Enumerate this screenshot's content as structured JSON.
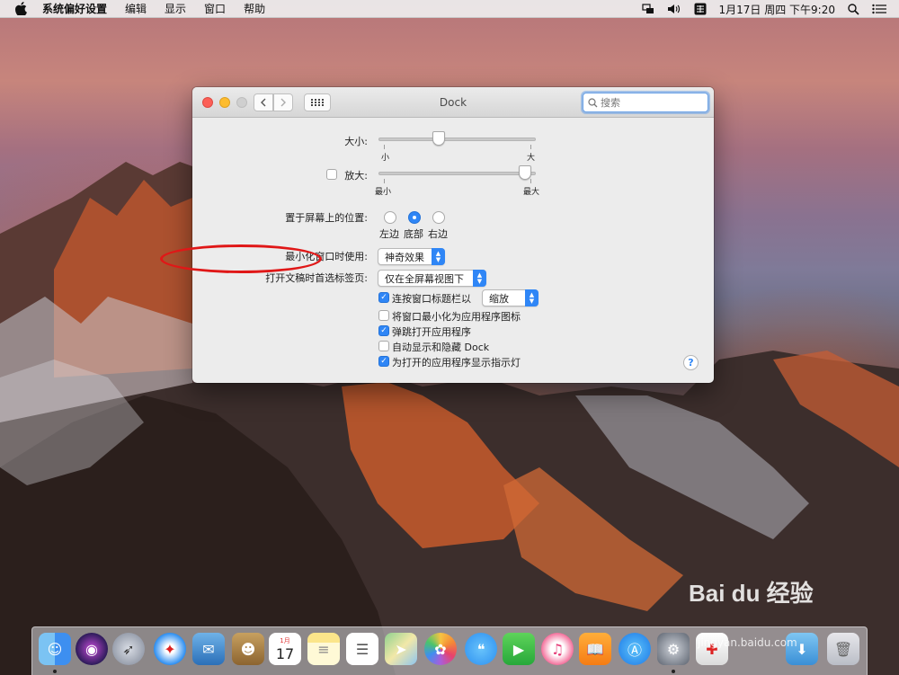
{
  "menubar": {
    "app_name": "系统偏好设置",
    "items": [
      "编辑",
      "显示",
      "窗口",
      "帮助"
    ],
    "clock": "1月17日 周四 下午9:20"
  },
  "window": {
    "title": "Dock",
    "search_placeholder": "搜索"
  },
  "settings": {
    "size_label": "大小:",
    "size_min": "小",
    "size_max": "大",
    "size_value": 0.37,
    "magnify_label": "放大:",
    "magnify_checked": false,
    "magnify_min": "最小",
    "magnify_max": "最大",
    "magnify_value": 0.97,
    "position_label": "置于屏幕上的位置:",
    "position_options": [
      "左边",
      "底部",
      "右边"
    ],
    "position_selected": "底部",
    "minimize_label": "最小化窗口时使用:",
    "minimize_value": "神奇效果",
    "tabs_label": "打开文稿时首选标签页:",
    "tabs_value": "仅在全屏幕视图下",
    "checkboxes": [
      {
        "label": "连按窗口标题栏以",
        "checked": true
      },
      {
        "label": "将窗口最小化为应用程序图标",
        "checked": false
      },
      {
        "label": "弹跳打开应用程序",
        "checked": true
      },
      {
        "label": "自动显示和隐藏 Dock",
        "checked": false
      },
      {
        "label": "为打开的应用程序显示指示灯",
        "checked": true
      }
    ],
    "doubleclick_value": "缩放"
  },
  "watermark": {
    "brand": "Bai du 经验",
    "url": "jingyan.baidu.com"
  },
  "dock": {
    "apps": [
      "finder",
      "siri",
      "launchpad",
      "safari",
      "mail",
      "contacts",
      "calendar",
      "notes",
      "reminders",
      "maps",
      "photos",
      "messages",
      "facetime",
      "itunes",
      "ibooks",
      "app-store",
      "system-preferences",
      "unknown-app",
      "downloads",
      "trash"
    ],
    "calendar_month": "1月",
    "calendar_day": "17",
    "colors": {
      "accent": "#2f86f6",
      "annotation": "#e01717"
    }
  }
}
